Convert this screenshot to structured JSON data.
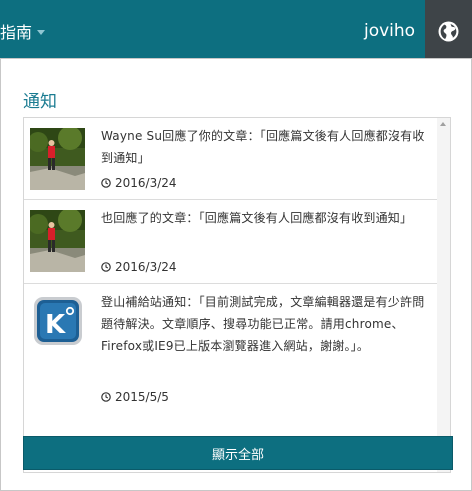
{
  "navbar": {
    "left_label": "指南",
    "user_name": "joviho",
    "globe_icon": "globe-icon",
    "background": "#0d6f80"
  },
  "panel": {
    "title": "通知",
    "show_all_label": "顯示全部",
    "items": [
      {
        "message": "Wayne Su回應了你的文章：「回應篇文後有人回應都沒有收到通知」",
        "date": "2016/3/24",
        "thumb_icon": "hiker-photo"
      },
      {
        "message": "也回應了的文章：「回應篇文後有人回應都沒有收到通知」",
        "date": "2016/3/24",
        "thumb_icon": "hiker-photo"
      },
      {
        "message": "登山補給站通知：「目前測試完成，文章編輯器還是有少許問題待解決。文章順序、搜尋功能已正常。請用chrome、Firefox或IE9已上版本瀏覽器進入網站，謝謝。」。",
        "date": "2015/5/5",
        "thumb_icon": "site-logo-k"
      }
    ]
  }
}
